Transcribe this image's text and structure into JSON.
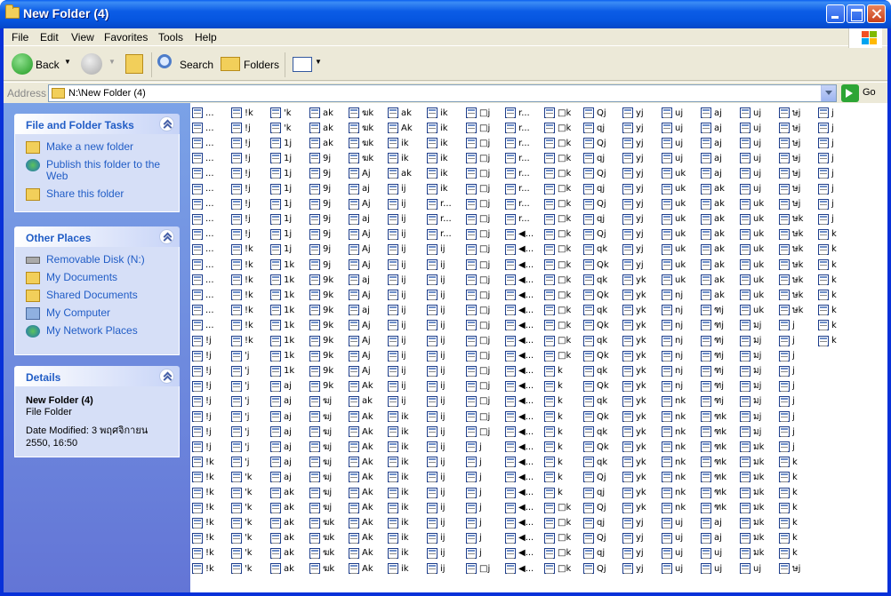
{
  "window": {
    "title": "New Folder (4)"
  },
  "menu": [
    "File",
    "Edit",
    "View",
    "Favorites",
    "Tools",
    "Help"
  ],
  "toolbar": {
    "back": "Back",
    "search": "Search",
    "folders": "Folders"
  },
  "address": {
    "label": "Address",
    "value": "N:\\New Folder (4)",
    "go": "Go"
  },
  "tasks": {
    "file_tasks": {
      "title": "File and Folder Tasks",
      "items": [
        "Make a new folder",
        "Publish this folder to the Web",
        "Share this folder"
      ]
    },
    "other_places": {
      "title": "Other Places",
      "items": [
        "Removable Disk (N:)",
        "My Documents",
        "Shared Documents",
        "My Computer",
        "My Network Places"
      ]
    },
    "details": {
      "title": "Details",
      "name": "New Folder (4)",
      "type": "File Folder",
      "modified": "Date Modified: 3 พฤศจิกายน 2550, 16:50"
    }
  },
  "files": {
    "columns": [
      [
        "...",
        "...",
        "...",
        "...",
        "...",
        "...",
        "...",
        "...",
        "...",
        "...",
        "...",
        "...",
        "...",
        "...",
        "...",
        "!j",
        "!j",
        "!j",
        "!j",
        "!j",
        "!j",
        "!j",
        "!j",
        "!k",
        "!k",
        "!k",
        "!k",
        "!k",
        "!k",
        "!k",
        "!k"
      ],
      [
        "!k",
        "!j",
        "!j",
        "!j",
        "!j",
        "!j",
        "!j",
        "!j",
        "!j",
        "!k",
        "!k",
        "!k",
        "!k",
        "!k",
        "!k",
        "!k",
        "'j",
        "'j",
        "'j",
        "'j",
        "'j",
        "'j",
        "'j",
        "'j",
        "'k",
        "'k",
        "'k",
        "'k",
        "'k",
        "'k",
        "'k"
      ],
      [
        "'k",
        "'k",
        "1j",
        "1j",
        "1j",
        "1j",
        "1j",
        "1j",
        "1j",
        "1j",
        "1k",
        "1k",
        "1k",
        "1k",
        "1k",
        "1k",
        "1k",
        "1k",
        "aj",
        "aj",
        "aj",
        "aj",
        "aj",
        "aj",
        "aj",
        "ak",
        "ak",
        "ak",
        "ak",
        "ak",
        "ak"
      ],
      [
        "ak",
        "ak",
        "ak",
        "9j",
        "9j",
        "9j",
        "9j",
        "9j",
        "9j",
        "9j",
        "9j",
        "9k",
        "9k",
        "9k",
        "9k",
        "9k",
        "9k",
        "9k",
        "9k",
        "ฆj",
        "ฆj",
        "ฆj",
        "ฆj",
        "ฆj",
        "ฆj",
        "ฆj",
        "ฆj",
        "ฆk",
        "ฆk",
        "ฆk",
        "ฆk"
      ],
      [
        "ฆk",
        "ฆk",
        "ฆk",
        "ฆk",
        "Aj",
        "aj",
        "Aj",
        "aj",
        "Aj",
        "Aj",
        "Aj",
        "aj",
        "Aj",
        "aj",
        "Aj",
        "Aj",
        "Aj",
        "Aj",
        "Ak",
        "ak",
        "Ak",
        "Ak",
        "Ak",
        "Ak",
        "Ak",
        "Ak",
        "Ak",
        "Ak",
        "Ak",
        "Ak",
        "Ak"
      ],
      [
        "ak",
        "Ak",
        "ik",
        "ik",
        "ak",
        "ij",
        "ij",
        "ij",
        "ij",
        "ij",
        "ij",
        "ij",
        "ij",
        "ij",
        "ij",
        "ij",
        "ij",
        "ij",
        "ij",
        "ij",
        "ik",
        "ik",
        "ik",
        "ik",
        "ik",
        "ik",
        "ik",
        "ik",
        "ik",
        "ik",
        "ik"
      ],
      [
        "ik",
        "ik",
        "ik",
        "ik",
        "ik",
        "ik",
        "r...",
        "r...",
        "r...",
        "ij",
        "ij",
        "ij",
        "ij",
        "ij",
        "ij",
        "ij",
        "ij",
        "ij",
        "ij",
        "ij",
        "ij",
        "ij",
        "ij",
        "ij",
        "ij",
        "ij",
        "ij",
        "ij",
        "ij",
        "ij",
        "ij"
      ],
      [
        "□j",
        "□j",
        "□j",
        "□j",
        "□j",
        "□j",
        "□j",
        "□j",
        "□j",
        "□j",
        "□j",
        "□j",
        "□j",
        "□j",
        "□j",
        "□j",
        "□j",
        "□j",
        "□j",
        "□j",
        "□j",
        "□j",
        "j",
        "j",
        "j",
        "j",
        "j",
        "j",
        "j",
        "j",
        "□j"
      ],
      [
        "r...",
        "r...",
        "r...",
        "r...",
        "r...",
        "r...",
        "r...",
        "r...",
        "◀...",
        "◀...",
        "◀...",
        "◀...",
        "◀...",
        "◀...",
        "◀...",
        "◀...",
        "◀...",
        "◀...",
        "◀...",
        "◀...",
        "◀...",
        "◀...",
        "◀...",
        "◀...",
        "◀...",
        "◀...",
        "◀...",
        "◀...",
        "◀...",
        "◀...",
        "◀..."
      ],
      [
        "□k",
        "□k",
        "□k",
        "□k",
        "□k",
        "□k",
        "□k",
        "□k",
        "□k",
        "□k",
        "□k",
        "□k",
        "□k",
        "□k",
        "□k",
        "□k",
        "□k",
        "k",
        "k",
        "k",
        "k",
        "k",
        "k",
        "k",
        "k",
        "k",
        "□k",
        "□k",
        "□k",
        "□k",
        "□k"
      ],
      [
        "Qj",
        "qj",
        "Qj",
        "qj",
        "Qj",
        "qj",
        "Qj",
        "qj",
        "Qj",
        "qk",
        "Qk",
        "qk",
        "Qk",
        "qk",
        "Qk",
        "qk",
        "Qk",
        "qk",
        "Qk",
        "qk",
        "Qk",
        "qk",
        "Qk",
        "qk",
        "Qj",
        "qj",
        "Qj",
        "qj",
        "Qj",
        "qj",
        "Qj"
      ],
      [
        "yj",
        "yj",
        "yj",
        "yj",
        "yj",
        "yj",
        "yj",
        "yj",
        "yj",
        "yj",
        "yj",
        "yk",
        "yk",
        "yk",
        "yk",
        "yk",
        "yk",
        "yk",
        "yk",
        "yk",
        "yk",
        "yk",
        "yk",
        "yk",
        "yk",
        "yk",
        "yk",
        "yj",
        "yj",
        "yj",
        "yj"
      ],
      [
        "uj",
        "uj",
        "uj",
        "uj",
        "uk",
        "uk",
        "uk",
        "uk",
        "uk",
        "uk",
        "uk",
        "uk",
        "nj",
        "nj",
        "nj",
        "nj",
        "nj",
        "nj",
        "nj",
        "nk",
        "nk",
        "nk",
        "nk",
        "nk",
        "nk",
        "nk",
        "nk",
        "uj",
        "uj",
        "uj",
        "uj"
      ],
      [
        "aj",
        "aj",
        "aj",
        "aj",
        "aj",
        "ak",
        "ak",
        "ak",
        "ak",
        "ak",
        "ak",
        "ak",
        "ak",
        "ฑj",
        "ฑj",
        "ฑj",
        "ฑj",
        "ฑj",
        "ฑj",
        "ฑj",
        "ฑk",
        "ฑk",
        "ฑk",
        "ฑk",
        "ฑk",
        "ฑk",
        "ฑk",
        "aj",
        "aj",
        "uj",
        "uj"
      ],
      [
        "uj",
        "uj",
        "uj",
        "uj",
        "uj",
        "uj",
        "uk",
        "uk",
        "uk",
        "uk",
        "uk",
        "uk",
        "uk",
        "uk",
        "มj",
        "มj",
        "มj",
        "มj",
        "มj",
        "มj",
        "มj",
        "มj",
        "มk",
        "มk",
        "มk",
        "มk",
        "มk",
        "มk",
        "มk",
        "มk",
        "uj"
      ],
      [
        "ษj",
        "ษj",
        "ษj",
        "ษj",
        "ษj",
        "ษj",
        "ษj",
        "ษk",
        "ษk",
        "ษk",
        "ษk",
        "ษk",
        "ษk",
        "ษk",
        "j",
        "j",
        "j",
        "j",
        "j",
        "j",
        "j",
        "j",
        "j",
        "k",
        "k",
        "k",
        "k",
        "k",
        "k",
        "k",
        "ษj"
      ],
      [
        "j",
        "j",
        "j",
        "j",
        "j",
        "j",
        "j",
        "j",
        "k",
        "k",
        "k",
        "k",
        "k",
        "k",
        "k",
        "k"
      ]
    ]
  }
}
